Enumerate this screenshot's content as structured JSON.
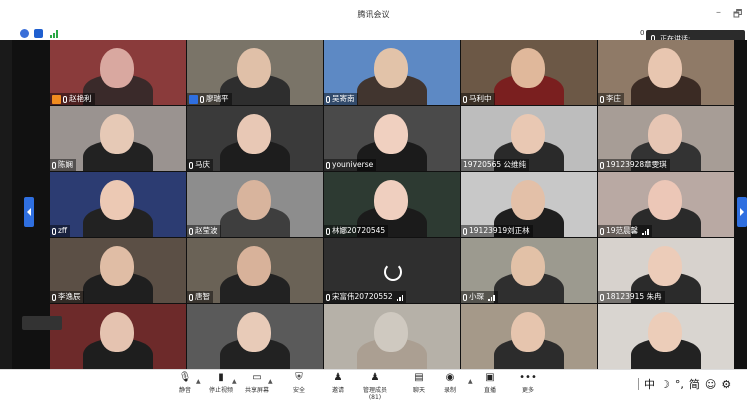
{
  "window": {
    "title": "腾讯会议",
    "minimize_label": "–",
    "restore_label": "🗗"
  },
  "status": {
    "network_icon": "signal-icon",
    "net_readout": "0",
    "speaking_label": "正在讲话:"
  },
  "participants": [
    {
      "name": "赵艳利",
      "badge": "host"
    },
    {
      "name": "廖瑞平",
      "badge": "cohost"
    },
    {
      "name": "吴寄南",
      "badge": ""
    },
    {
      "name": "马利中",
      "badge": ""
    },
    {
      "name": "李庄",
      "badge": ""
    },
    {
      "name": "陈娴",
      "badge": ""
    },
    {
      "name": "马庆",
      "badge": ""
    },
    {
      "name": "youniverse",
      "badge": ""
    },
    {
      "name": "19720565 公维纯",
      "badge": "",
      "nomic": true
    },
    {
      "name": "19123928章雯琪",
      "badge": ""
    },
    {
      "name": "zff",
      "badge": ""
    },
    {
      "name": "赵莹波",
      "badge": ""
    },
    {
      "name": "林娜20720545",
      "badge": ""
    },
    {
      "name": "19123919刘正林",
      "badge": ""
    },
    {
      "name": "19范晨馨",
      "badge": "",
      "vol": true
    },
    {
      "name": "李逸辰",
      "badge": ""
    },
    {
      "name": "唐智",
      "badge": ""
    },
    {
      "name": "宋富伟20720552",
      "badge": "",
      "vol": true,
      "loading": true
    },
    {
      "name": "小琛",
      "badge": "",
      "vol": true
    },
    {
      "name": "18123915 朱冉",
      "badge": ""
    },
    {
      "name": "",
      "badge": ""
    },
    {
      "name": "",
      "badge": ""
    },
    {
      "name": "",
      "badge": ""
    },
    {
      "name": "",
      "badge": ""
    },
    {
      "name": "",
      "badge": ""
    }
  ],
  "toolbar": {
    "items": [
      {
        "label": "静音",
        "icon": "mic-icon"
      },
      {
        "label": "停止视频",
        "icon": "camera-icon"
      },
      {
        "label": "共享屏幕",
        "icon": "share-screen-icon"
      },
      {
        "label": "安全",
        "icon": "shield-icon"
      },
      {
        "label": "邀请",
        "icon": "invite-icon"
      },
      {
        "label": "管理成员(81)",
        "icon": "members-icon"
      },
      {
        "label": "聊天",
        "icon": "chat-icon"
      },
      {
        "label": "录制",
        "icon": "record-icon"
      },
      {
        "label": "直播",
        "icon": "live-icon"
      },
      {
        "label": "更多",
        "icon": "more-icon"
      }
    ]
  },
  "ime": {
    "lang": "中",
    "moon": "☽",
    "punct": "°,",
    "width": "简",
    "emoji": "☺",
    "gear": "⚙"
  },
  "colors": {
    "host_badge": "#f28c1f",
    "cohost_badge": "#2f6fe0",
    "nav_arrow": "#2f6fe0",
    "signal": "#2aa845"
  }
}
